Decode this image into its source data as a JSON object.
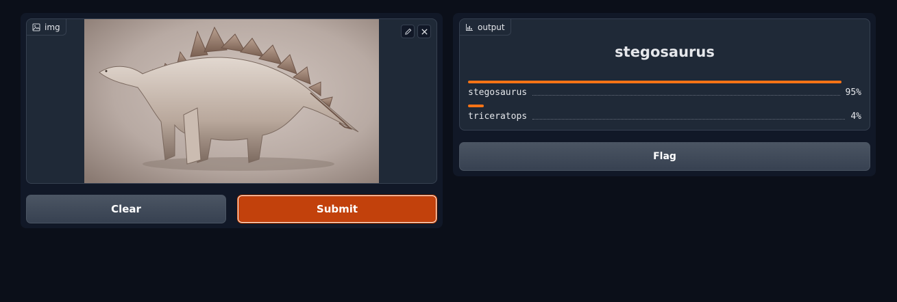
{
  "input_panel": {
    "image_label": "img",
    "icons": {
      "label": "image-icon",
      "edit": "pencil-icon",
      "clear": "close-icon"
    },
    "clear_label": "Clear",
    "submit_label": "Submit"
  },
  "output_panel": {
    "label": "output",
    "label_icon": "bar-chart-icon",
    "top_label": "stegosaurus",
    "confidences": [
      {
        "label": "stegosaurus",
        "value": "95%",
        "fraction": 0.95
      },
      {
        "label": "triceratops",
        "value": "4%",
        "fraction": 0.04
      }
    ],
    "flag_label": "Flag"
  },
  "colors": {
    "background": "#0b0f19",
    "panel": "#111827",
    "block": "#1f2937",
    "accent": "#f97316",
    "submit": "#c2410c"
  }
}
